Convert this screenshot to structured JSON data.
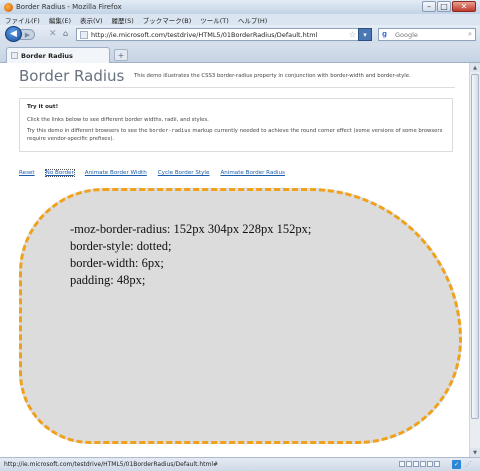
{
  "window": {
    "title": "Border Radius - Mozilla Firefox",
    "minimize": "–",
    "maximize": "□",
    "close": "✕"
  },
  "menu": [
    "ファイル(F)",
    "編集(E)",
    "表示(V)",
    "履歴(S)",
    "ブックマーク(B)",
    "ツール(T)",
    "ヘルプ(H)"
  ],
  "nav": {
    "back_glyph": "◀",
    "forward_glyph": "▶",
    "stop_glyph": "✕",
    "home_glyph": "⌂",
    "url": "http://ie.microsoft.com/testdrive/HTML5/01BorderRadius/Default.html",
    "star_glyph": "☆",
    "search_engine_glyph": "g",
    "search_placeholder": "Google",
    "search_glyph": "⌕"
  },
  "tabs": {
    "active_label": "Border Radius",
    "new_tab": "+"
  },
  "page": {
    "title": "Border Radius",
    "description": "This demo illustrates the CSS3 border-radius property in conjunction with border-width and border-style.",
    "try_heading": "Try it out!",
    "try_line1": "Click the links below to see different border widths, radii, and styles.",
    "try_line2_a": "Try this demo in different browsers to see the ",
    "try_line2_code": "border-radius",
    "try_line2_b": " markup currently needed to achieve the round corner effect (some versions of some browsers require vendor-specific prefixes).",
    "links": {
      "reset": "Reset",
      "no_border": "No Border",
      "animate_width": "Animate Border Width",
      "cycle_style": "Cycle Border Style",
      "animate_radius": "Animate Border Radius"
    },
    "demo_code": {
      "line1": "-moz-border-radius: 152px 304px 228px 152px;",
      "line2": "border-style: dotted;",
      "line3": "border-width: 6px;",
      "line4": "padding: 48px;"
    },
    "demo_border_color": "#f0a11c",
    "demo_background": "#dcdcdc"
  },
  "status": {
    "text": "http://ie.microsoft.com/testdrive/HTML5/01BorderRadius/Default.html#"
  }
}
